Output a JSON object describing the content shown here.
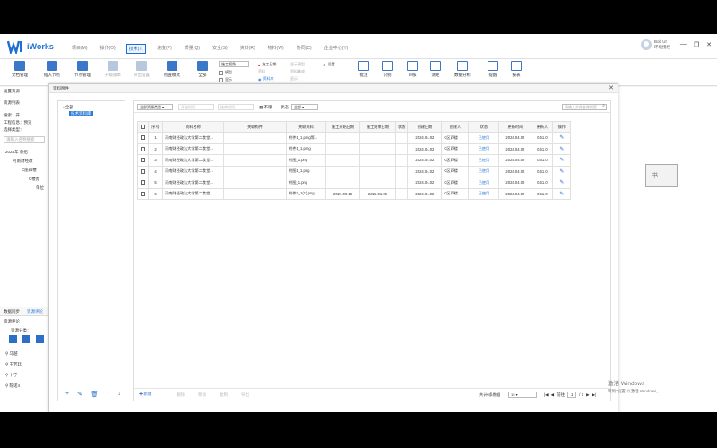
{
  "app": {
    "name": "iWorks"
  },
  "menu": [
    "项目(M)",
    "操作(O)",
    "技术(T)",
    "进度(P)",
    "质量(Q)",
    "安全(S)",
    "资料(R)",
    "物料(W)",
    "协同(C)",
    "企业中心(Y)"
  ],
  "menu_active": 2,
  "user": {
    "name": "Bob Ur",
    "sub": "环境授权"
  },
  "window_controls": [
    "—",
    "❐",
    "✕"
  ],
  "ribbon": {
    "buttons": [
      {
        "label": "文档管理",
        "color": "#3b78c9"
      },
      {
        "label": "插入节点",
        "color": "#3b78c9"
      },
      {
        "label": "节点管理",
        "color": "#3b78c9"
      },
      {
        "label": "升级版本",
        "color": "#b7c7dd",
        "dim": true
      },
      {
        "label": "导出设置",
        "color": "#b7c7dd",
        "dim": true
      },
      {
        "label": "检查模式",
        "color": "#3b78c9"
      },
      {
        "label": "全部",
        "color": "#3b78c9"
      }
    ],
    "dropdown": "施工视角",
    "checks": [
      "模型",
      "显示"
    ],
    "small": [
      "施工日期",
      "资料",
      "资料库",
      "显示模型",
      "资料集成",
      "显示",
      "设置"
    ],
    "right_buttons": [
      {
        "label": "批注",
        "color": "#3b78c9"
      },
      {
        "label": "识别",
        "color": "#3b78c9"
      },
      {
        "label": "审核",
        "color": "#3b78c9"
      },
      {
        "label": "测距",
        "color": "#3b78c9"
      },
      {
        "label": "数据分析",
        "color": "#3b78c9"
      },
      {
        "label": "提醒",
        "color": "#3b78c9"
      },
      {
        "label": "报表",
        "color": "#3b78c9"
      }
    ]
  },
  "left_panel": {
    "heading": "设置资源",
    "subheading": "资源列表",
    "lines": [
      "搜索：开",
      "工程信息：预览",
      "选择类型：",
      "请输入名称搜索"
    ],
    "tree": [
      "2024年 春招",
      "河南财经政",
      "C座四楼",
      "C楼办",
      "单位"
    ],
    "tabs": [
      "数据同步",
      "资源评论"
    ],
    "section": "资源评论",
    "filter": "资源分类：",
    "people": [
      "马越",
      "王芳廷",
      "卜宁",
      "陈诺4"
    ]
  },
  "dialog": {
    "title": "资料附件",
    "close": "✕",
    "tree_root": "全部",
    "tree_selected": "技术资料库",
    "tree_tools": [
      "+",
      "✎",
      "🗑",
      "↑",
      "↓"
    ],
    "toolbar": {
      "select1": "全部资源类型",
      "select2": "开始时间",
      "select3": "结束时间",
      "toggle": "不限",
      "status_label": "状态",
      "status_value": "全部",
      "search_placeholder": "请输入文件名称搜索"
    },
    "columns": [
      "",
      "序号",
      "资料名称",
      "关联构件",
      "关联资料",
      "施工开始日期",
      "施工结束日期",
      "状态",
      "创建日期",
      "创建人",
      "状态",
      "更新时间",
      "更新人",
      "操作"
    ],
    "rows": [
      {
        "no": "1",
        "name": "河南财经政法大学第二食堂...",
        "comp": "",
        "file": "附件1_1.pmg等...",
        "start": "",
        "end": "",
        "s": "",
        "created": "2024.04.02",
        "creator": "C区四楼",
        "status": "已使用",
        "updated": "2024.04.02",
        "updater": "0.61.0",
        "op": "✎"
      },
      {
        "no": "2",
        "name": "河南财经政法大学第二食堂...",
        "comp": "",
        "file": "附件1_1.pmg",
        "start": "",
        "end": "",
        "s": "",
        "created": "2024.04.02",
        "creator": "C区四楼",
        "status": "已使用",
        "updated": "2024.04.02",
        "updater": "0.61.0",
        "op": "✎"
      },
      {
        "no": "3",
        "name": "河南财经政法大学第二食堂...",
        "comp": "",
        "file": "附图_1.png",
        "start": "",
        "end": "",
        "s": "",
        "created": "2024.04.02",
        "creator": "C区四楼",
        "status": "已使用",
        "updated": "2024.04.02",
        "updater": "0.61.0",
        "op": "✎"
      },
      {
        "no": "4",
        "name": "河南财经政法大学第二食堂...",
        "comp": "",
        "file": "附图1_1.png",
        "start": "",
        "end": "",
        "s": "",
        "created": "2024.04.02",
        "creator": "C区四楼",
        "status": "已使用",
        "updated": "2024.04.02",
        "updater": "0.61.0",
        "op": "✎"
      },
      {
        "no": "5",
        "name": "河南财经政法大学第二食堂...",
        "comp": "",
        "file": "附图_1.png",
        "start": "",
        "end": "",
        "s": "",
        "created": "2024.04.02",
        "creator": "C区四楼",
        "status": "已使用",
        "updated": "2024.04.02",
        "updater": "0.61.0",
        "op": "✎"
      },
      {
        "no": "6",
        "name": "河南财经政法大学第二食堂...",
        "comp": "",
        "file": "附件2_1(1).png...",
        "start": "2021.09.13",
        "end": "2022.01.05",
        "s": "",
        "created": "2024.04.02",
        "creator": "C区四楼",
        "status": "已使用",
        "updated": "2024.04.02",
        "updater": "0.61.0",
        "op": "✎"
      }
    ],
    "footer": {
      "add": "新建",
      "disabled": [
        "删除",
        "移动",
        "复制",
        "导出"
      ],
      "total_label": "共计6条数据",
      "page_size": "15",
      "page_label": "前往",
      "page": "1",
      "page_total": "/ 1"
    }
  },
  "book_label": "书",
  "watermark": {
    "line1": "激活 Windows",
    "line2": "转到\"设置\"以激活 Windows。"
  }
}
